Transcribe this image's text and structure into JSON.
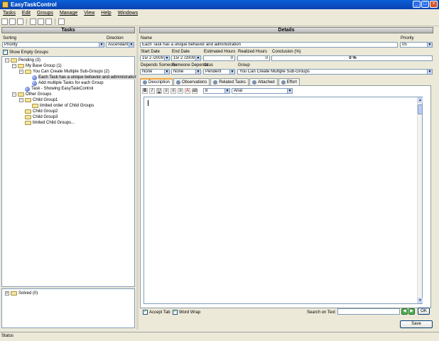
{
  "window": {
    "title": "EasyTaskControl"
  },
  "menu": [
    "Tasks",
    "Edit",
    "Groups",
    "Manage",
    "View",
    "Help",
    "Windows"
  ],
  "left": {
    "header": "Tasks",
    "sorting_label": "Sorting",
    "sorting_value": "Priority",
    "direction_label": "Direction",
    "direction_value": "Ascendant",
    "show_empty_label": "Show Empty Groups",
    "tree": [
      "Pending (3)",
      "My Base Group (1)",
      "You Can Create Multiple Sub-Groups (2)",
      "Each Task has a unique behavior and administration",
      "Add multiple Tasks for each Group",
      "Task - Showing EasyTaskControl",
      "Other Groups",
      "Child Group1",
      "limited order of Child Groups",
      "Child Group2",
      "Child Group3",
      "limited Child Groups..."
    ],
    "solved": "Solved (0)"
  },
  "details": {
    "header": "Details",
    "name_label": "Name",
    "name_value": "Each Task has a unique behavior and administration",
    "priority_label": "Priority",
    "priority_value": "05",
    "start_label": "Start Date",
    "start_value": "15/ 2 /2009",
    "end_label": "End Date",
    "end_value": "15/ 2 /2009",
    "est_label": "Estimated Hours",
    "est_value": "0",
    "real_label": "Realized Hours",
    "real_value": "0",
    "conclusion_label": "Conclusion (%)",
    "conclusion_value": "0 %",
    "depends_label": "Depends Someone",
    "depends_value": "None",
    "someone_label": "Someone Depends",
    "someone_value": "None",
    "status_label": "tatus",
    "status_value": "Pendent",
    "group_label": "Group",
    "group_value": "You Can Create Multiple Sub-Groups",
    "tabs": [
      "Description",
      "Observations",
      "Related Tasks",
      "Attached",
      "Effort"
    ],
    "font_size": "8",
    "font_name": "Arial",
    "accept_tab": "Accept Tab",
    "word_wrap": "Word Wrap",
    "search_label": "Search on Text",
    "ok": "OK",
    "save": "Save"
  },
  "status": "Status"
}
